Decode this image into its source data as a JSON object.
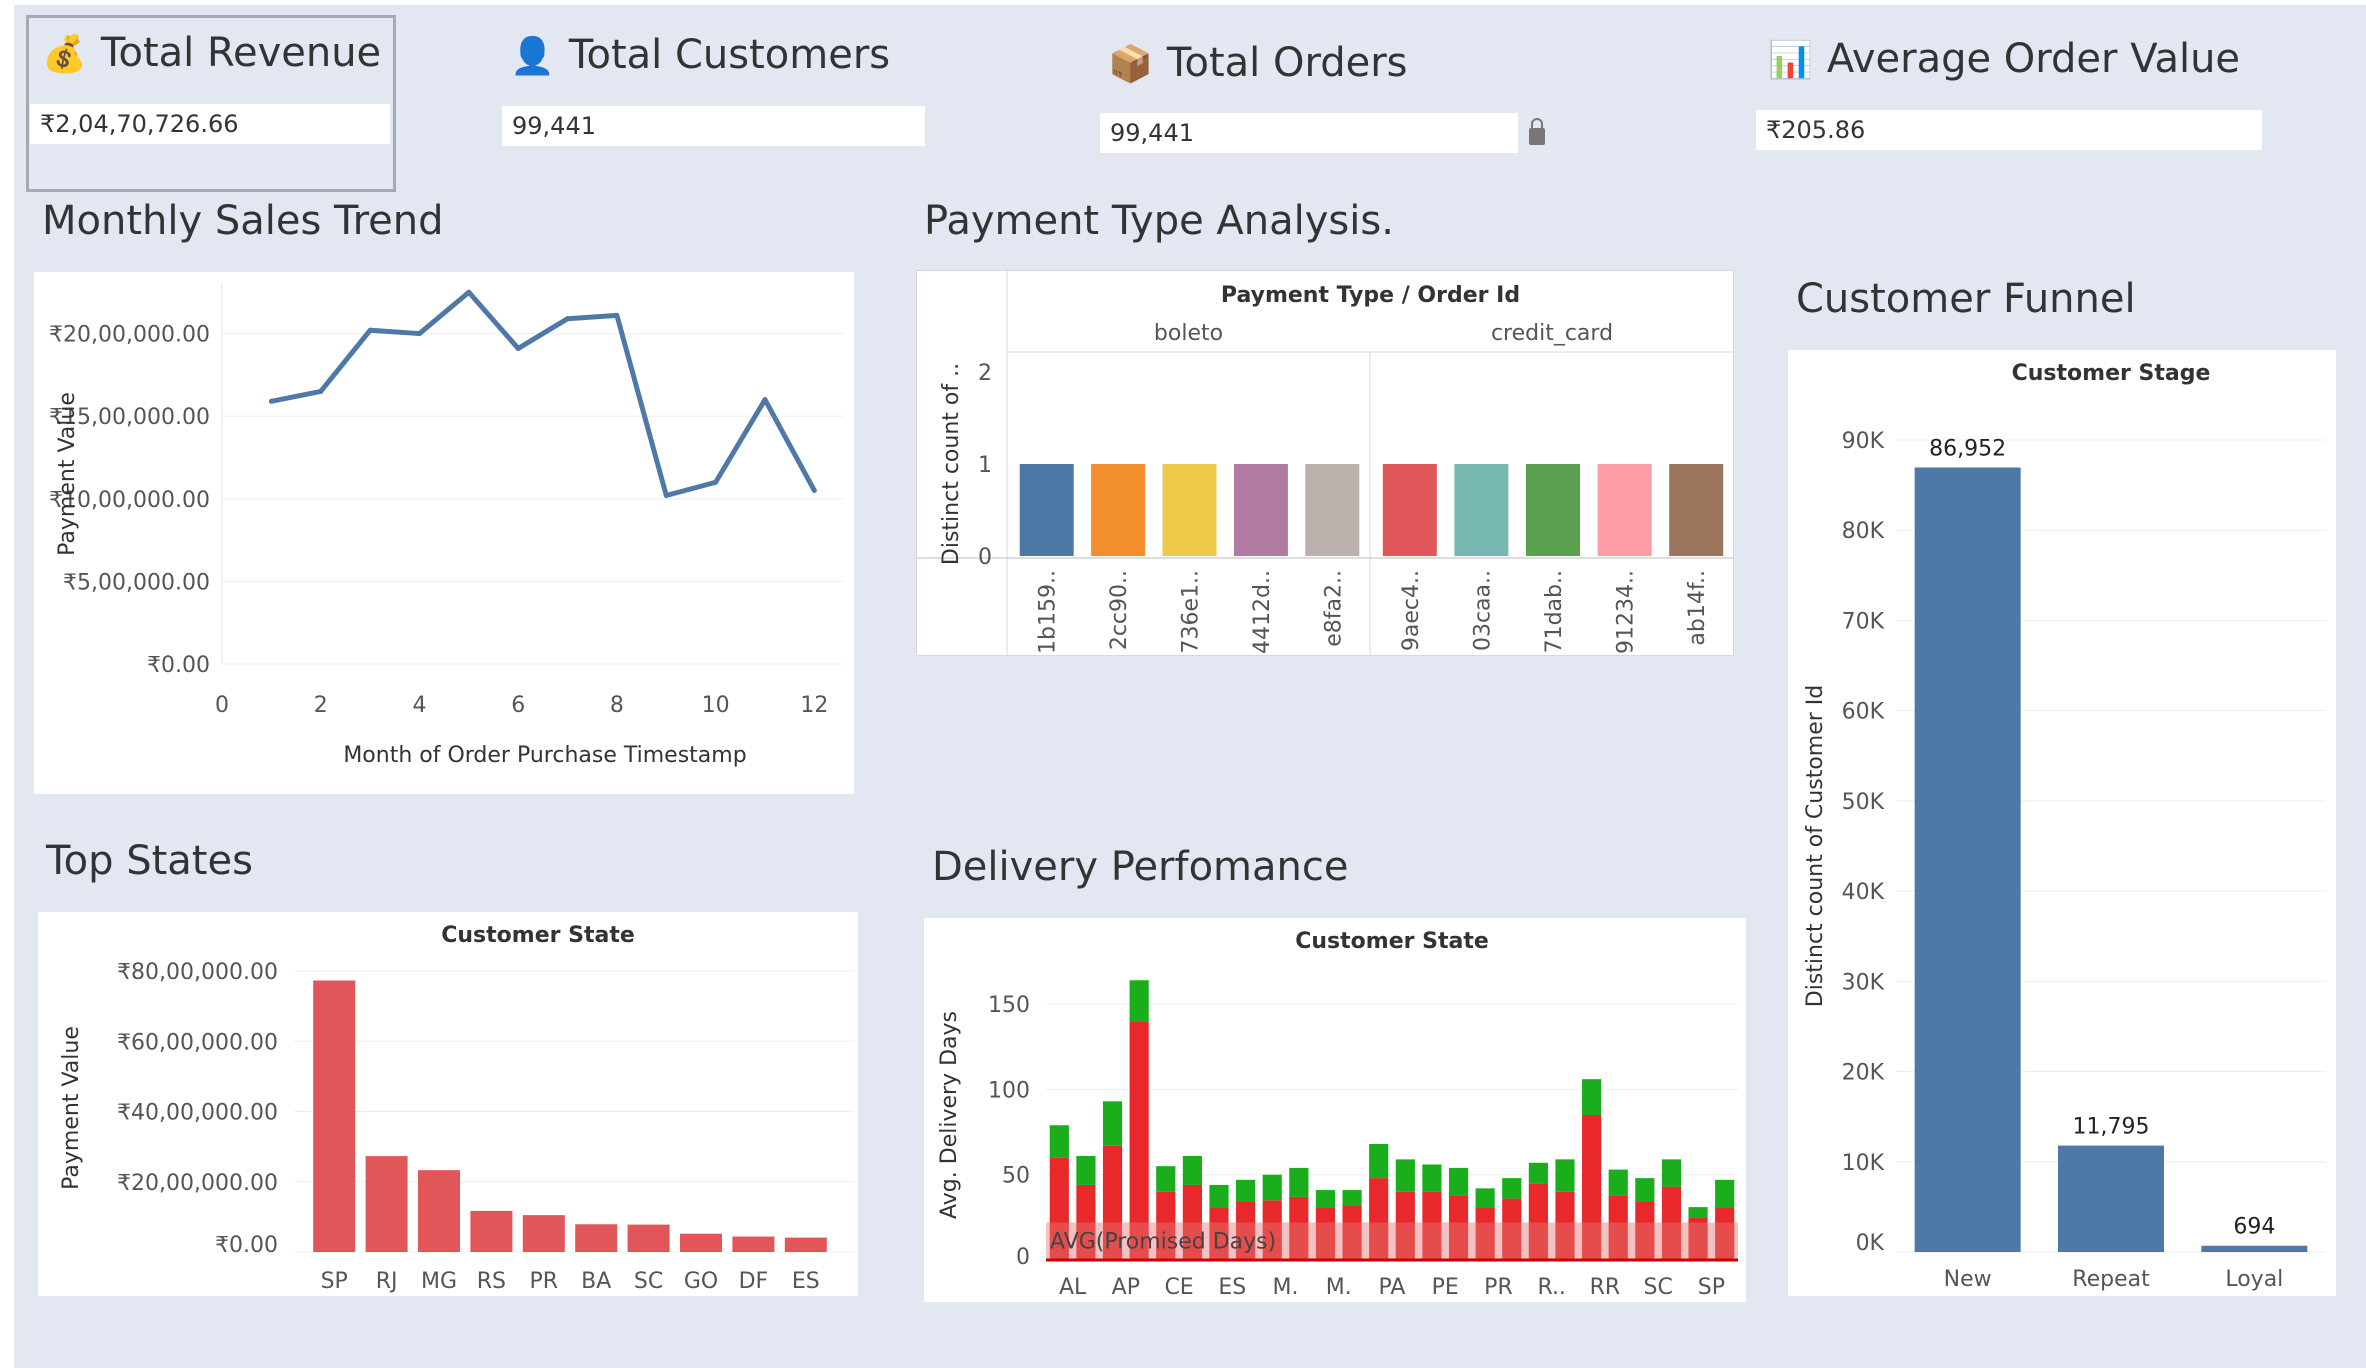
{
  "kpis": [
    {
      "title": "Total Revenue",
      "value": "₹2,04,70,726.66",
      "icon": "money-bag-icon"
    },
    {
      "title": "Total Customers",
      "value": "99,441",
      "icon": "person-icon"
    },
    {
      "title": "Total Orders",
      "value": "99,441",
      "icon": "package-icon"
    },
    {
      "title": "Average Order Value",
      "value": "₹205.86",
      "icon": "bar-chart-icon"
    }
  ],
  "sections": {
    "monthly": "Monthly Sales Trend",
    "payment": "Payment Type Analysis.",
    "funnel": "Customer Funnel",
    "states": "Top States",
    "delivery": "Delivery Perfomance"
  },
  "colors": {
    "line": "#4e79a7",
    "state_bars": "#e15759",
    "funnel_bars": "#4e79a7",
    "delivery_red": "#e8282b",
    "delivery_green": "#1aae1c",
    "dashboard_bg": "#e3e7f2"
  },
  "chart_data": [
    {
      "id": "monthly",
      "type": "line",
      "xlabel": "Month of Order Purchase Timestamp",
      "ylabel": "Payment Value",
      "x_ticks": [
        0,
        2,
        4,
        6,
        8,
        10,
        12
      ],
      "y_ticks": [
        "₹0.00",
        "₹5,00,000.00",
        "₹10,00,000.00",
        "₹15,00,000.00",
        "₹20,00,000.00"
      ],
      "y_tick_values": [
        0,
        500000,
        1000000,
        1500000,
        2000000
      ],
      "xlim": [
        0,
        12.6
      ],
      "ylim": [
        0,
        2300000
      ],
      "grid": true,
      "x": [
        1,
        2,
        3,
        4,
        5,
        6,
        7,
        8,
        9,
        10,
        11,
        12
      ],
      "y": [
        1590000,
        1650000,
        2020000,
        2000000,
        2250000,
        1910000,
        2090000,
        2110000,
        1020000,
        1100000,
        1600000,
        1050000
      ]
    },
    {
      "id": "payment",
      "type": "bar",
      "header": "Payment Type  /  Order Id",
      "ylabel": "Distinct count of ..",
      "ylim": [
        0,
        2
      ],
      "y_ticks": [
        0,
        1,
        2
      ],
      "groups": [
        {
          "name": "boleto",
          "categories": [
            "1b159..",
            "2cc90..",
            "736e1..",
            "4412d..",
            "e8fa2.."
          ],
          "values": [
            1,
            1,
            1,
            1,
            1
          ],
          "colors": [
            "#4e79a7",
            "#f28e2b",
            "#edc948",
            "#b07aa1",
            "#bab0ac"
          ]
        },
        {
          "name": "credit_card",
          "categories": [
            "9aec4..",
            "03caa..",
            "71dab..",
            "91234..",
            "ab14f.."
          ],
          "values": [
            1,
            1,
            1,
            1,
            1
          ],
          "colors": [
            "#e15759",
            "#76b7b2",
            "#59a14f",
            "#ff9da7",
            "#9c755f"
          ]
        }
      ]
    },
    {
      "id": "funnel",
      "type": "bar",
      "header": "Customer Stage",
      "ylabel": "Distinct count of Customer Id",
      "categories": [
        "New",
        "Repeat",
        "Loyal"
      ],
      "values": [
        86952,
        11795,
        694
      ],
      "value_labels": [
        "86,952",
        "11,795",
        "694"
      ],
      "y_ticks": [
        "0K",
        "10K",
        "20K",
        "30K",
        "40K",
        "50K",
        "60K",
        "70K",
        "80K",
        "90K"
      ],
      "ylim": [
        0,
        90000
      ]
    },
    {
      "id": "states",
      "type": "bar",
      "header": "Customer State",
      "ylabel": "Payment Value",
      "categories": [
        "SP",
        "RJ",
        "MG",
        "RS",
        "PR",
        "BA",
        "SC",
        "GO",
        "DF",
        "ES"
      ],
      "values": [
        7730000,
        2730000,
        2330000,
        1170000,
        1050000,
        790000,
        780000,
        520000,
        440000,
        410000
      ],
      "y_ticks": [
        "₹0.00",
        "₹20,00,000.00",
        "₹40,00,000.00",
        "₹60,00,000.00",
        "₹80,00,000.00"
      ],
      "y_tick_values": [
        0,
        2000000,
        4000000,
        6000000,
        8000000
      ],
      "ylim": [
        0,
        8200000
      ]
    },
    {
      "id": "delivery",
      "type": "bar",
      "stacked": true,
      "header": "Customer State",
      "ylabel": "Avg. Delivery Days",
      "x_tick_labels": [
        "AL",
        "AP",
        "CE",
        "ES",
        "M.",
        "M.",
        "PA",
        "PE",
        "PR",
        "R..",
        "RR",
        "SC",
        "SP"
      ],
      "y_ticks": [
        0,
        50,
        100,
        150
      ],
      "ylim": [
        0,
        170
      ],
      "reference_line": {
        "label": "AVG(Promised Days)",
        "value": 22
      },
      "series": [
        {
          "name": "red",
          "values": [
            60,
            44,
            67,
            140,
            40,
            44,
            31,
            34,
            35,
            37,
            31,
            32,
            48,
            40,
            40,
            38,
            31,
            36,
            45,
            40,
            85,
            38,
            34,
            43,
            25,
            31
          ]
        },
        {
          "name": "green",
          "values": [
            19,
            17,
            26,
            24,
            15,
            17,
            13,
            13,
            15,
            17,
            10,
            9,
            20,
            19,
            16,
            16,
            11,
            12,
            12,
            19,
            21,
            15,
            14,
            16,
            6,
            16
          ]
        }
      ]
    }
  ]
}
